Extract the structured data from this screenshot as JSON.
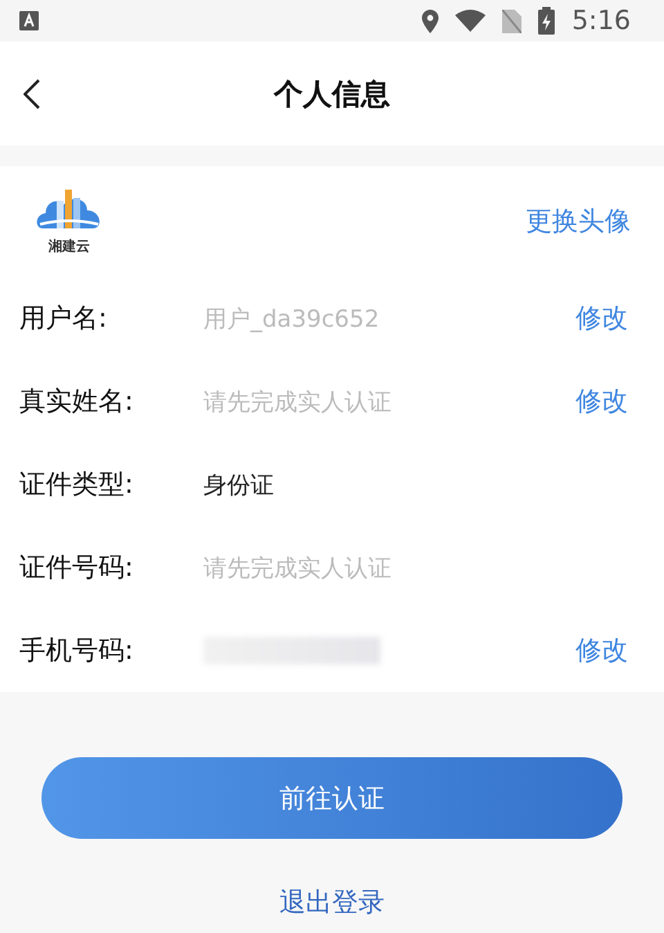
{
  "status_bar": {
    "time": "5:16"
  },
  "header": {
    "title": "个人信息"
  },
  "avatar": {
    "logo_text": "湘建云",
    "action": "更换头像"
  },
  "rows": [
    {
      "label": "用户名:",
      "placeholder": "用户_da39c652",
      "action": "修改"
    },
    {
      "label": "真实姓名:",
      "placeholder": "请先完成实人认证",
      "action": "修改"
    },
    {
      "label": "证件类型:",
      "value": "身份证"
    },
    {
      "label": "证件号码:",
      "placeholder": "请先完成实人认证"
    },
    {
      "label": "手机号码:",
      "masked": true,
      "action": "修改"
    }
  ],
  "primary_button": "前往认证",
  "logout_link": "退出登录"
}
